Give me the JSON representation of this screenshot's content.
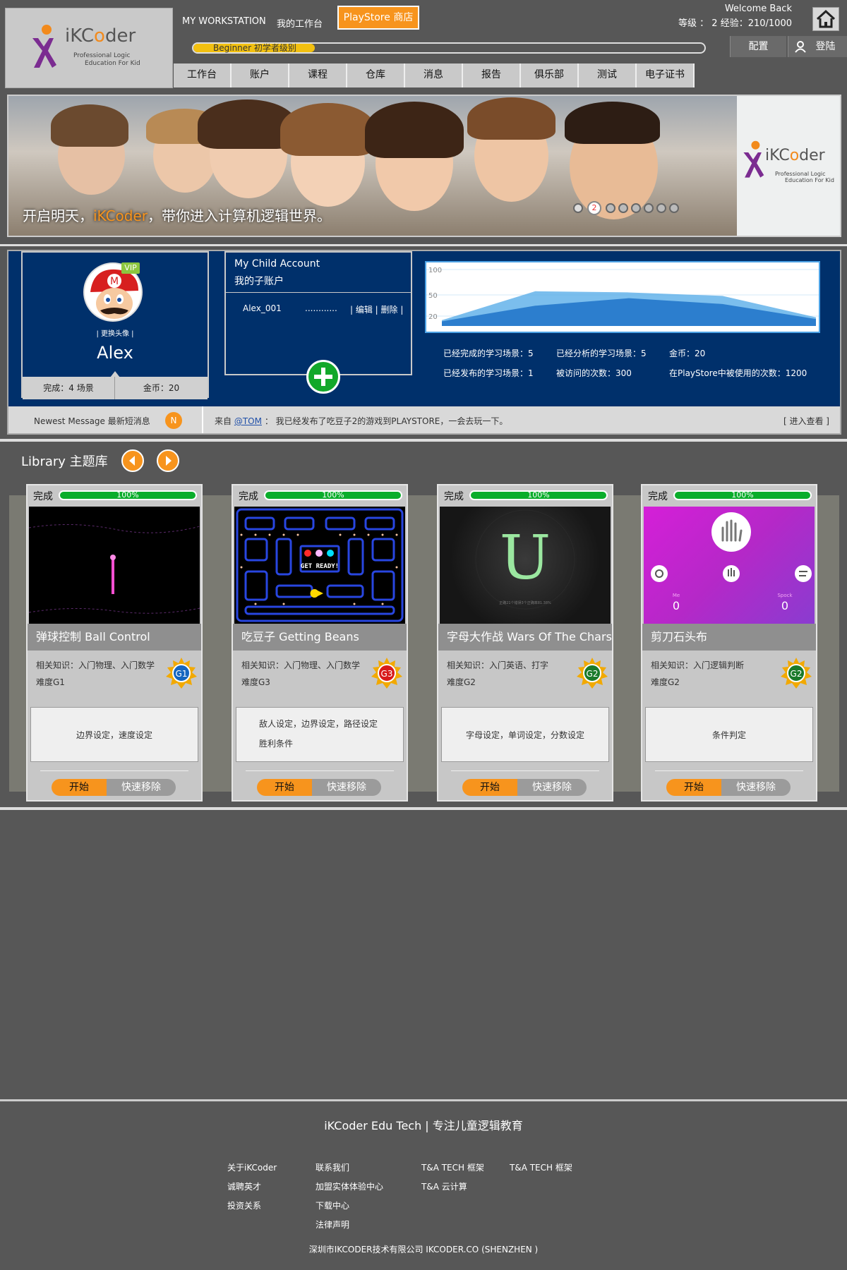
{
  "brand": {
    "name": "iKCoder",
    "tagline_1": "Professional Logic",
    "tagline_2": "Education For Kid"
  },
  "topbar": {
    "workstation_en": "MY WORKSTATION",
    "workstation_cn": "我的工作台",
    "playstore": "PlayStore 商店",
    "welcome": "Welcome Back",
    "level_info": "等级 ： 2  经验：210/1000",
    "level_badge": "Beginner 初学者级别",
    "level_progress": 0.24,
    "config": "配置",
    "login": "登陆"
  },
  "nav": {
    "items": [
      "工作台",
      "账户",
      "课程",
      "仓库",
      "消息",
      "报告",
      "俱乐部",
      "测试",
      "电子证书"
    ]
  },
  "banner": {
    "caption_pre": "开启明天，",
    "caption_hl": "iKCoder",
    "caption_post": "，带你进入计算机逻辑世界。",
    "active_slide": "2"
  },
  "profile": {
    "vip": "VIP",
    "change_avatar": "| 更换头像 |",
    "name": "Alex",
    "completed": "完成：4 场景",
    "coins": "金币：20"
  },
  "child_account": {
    "title_en": "My Child Account",
    "title_cn": "我的子账户",
    "row_name": "Alex_001",
    "row_dots": "............",
    "row_actions": "| 编辑 | 删除 |"
  },
  "chart_data": {
    "type": "area",
    "title": "",
    "xlabel": "",
    "ylabel": "",
    "yticks": [
      "100",
      "50",
      "20"
    ],
    "series": [
      {
        "values": [
          10,
          60,
          58,
          52,
          15
        ]
      },
      {
        "values": [
          8,
          35,
          48,
          38,
          12
        ]
      }
    ],
    "colors": [
      "#5aaee8",
      "#1e73c8"
    ]
  },
  "stats": {
    "completed_scenes": "已经完成的学习场景：5",
    "analyzed_scenes": "已经分析的学习场景：5",
    "coins": "金币：20",
    "published_scenes": "已经发布的学习场景：1",
    "visits": "被访问的次数：300",
    "playstore_uses": "在PlayStore中被使用的次数：1200"
  },
  "message": {
    "label": "Newest Message 最新短消息",
    "badge": "N",
    "from_prefix": "来自",
    "from_user": "@TOM",
    "text": "： 我已经发布了吃豆子2的游戏到PLAYSTORE，一会去玩一下。",
    "view": "[ 进入查看 ]"
  },
  "library": {
    "title": "Library 主题库",
    "cards": [
      {
        "done": "完成",
        "progress": "100%",
        "title_cn": "弹球控制",
        "title_en": "Ball Control",
        "knowledge": "相关知识：入门物理、入门数学",
        "difficulty": "难度G1",
        "grade": "G1",
        "grade_color": "#1566c0",
        "desc_1": "边界设定，速度设定",
        "desc_2": "",
        "start": "开始",
        "remove": "快速移除"
      },
      {
        "done": "完成",
        "progress": "100%",
        "title_cn": "吃豆子",
        "title_en": "Getting Beans",
        "knowledge": "相关知识：入门物理、入门数学",
        "difficulty": "难度G3",
        "grade": "G3",
        "grade_color": "#d81b1b",
        "desc_1": "敌人设定，边界设定，路径设定",
        "desc_2": "胜利条件",
        "start": "开始",
        "remove": "快速移除"
      },
      {
        "done": "完成",
        "progress": "100%",
        "title_cn": "字母大作战",
        "title_en": "Wars Of The Chars",
        "knowledge": "相关知识：入门英语、打字",
        "difficulty": "难度G2",
        "grade": "G2",
        "grade_color": "#1a7a2a",
        "desc_1": "字母设定，单词设定，分数设定",
        "desc_2": "",
        "start": "开始",
        "remove": "快速移除"
      },
      {
        "done": "完成",
        "progress": "100%",
        "title_cn": "剪刀石头布",
        "title_en": "",
        "knowledge": "相关知识：入门逻辑判断",
        "difficulty": "难度G2",
        "grade": "G2",
        "grade_color": "#1a7a2a",
        "desc_1": "条件判定",
        "desc_2": "",
        "start": "开始",
        "remove": "快速移除"
      }
    ],
    "pac_text": "GET READY!",
    "chars_letter": "U",
    "chars_caption": "正确21个错误3个正确率81.38%",
    "rps_me": "Me",
    "rps_spock": "Spock",
    "rps_me_score": "0",
    "rps_spock_score": "0"
  },
  "footer": {
    "title": "iKCoder Edu Tech | 专注儿童逻辑教育",
    "col1": [
      "关于iKCoder",
      "诚聘英才",
      "投资关系"
    ],
    "col2": [
      "联系我们",
      "加盟实体体验中心",
      "下载中心",
      "法律声明"
    ],
    "col3": [
      "T&A TECH 框架",
      "T&A 云计算"
    ],
    "col4": [
      "T&A TECH 框架"
    ],
    "copyright": "深圳市IKCODER技术有限公司 IKCODER.CO (SHENZHEN )"
  }
}
